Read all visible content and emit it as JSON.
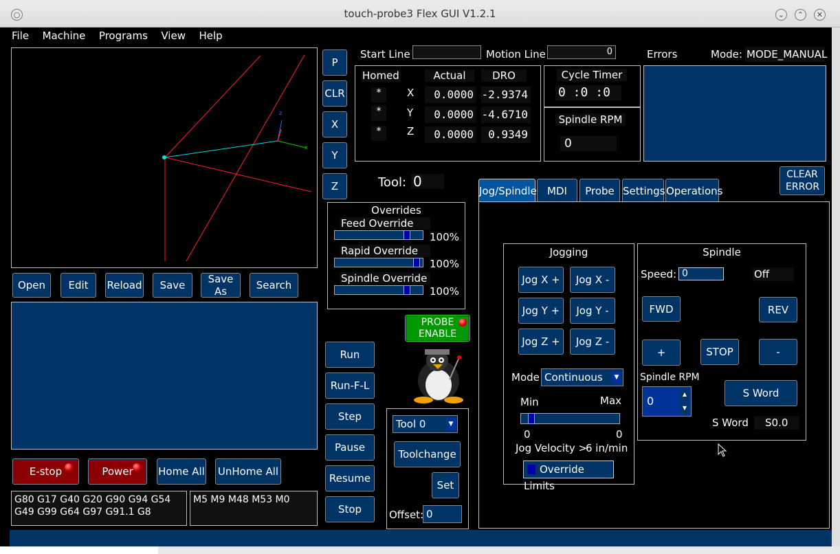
{
  "window": {
    "title": "touch-probe3 Flex GUI V1.2.1"
  },
  "menu": [
    "File",
    "Machine",
    "Programs",
    "View",
    "Help"
  ],
  "left_buttons": [
    "P",
    "CLR",
    "X",
    "Y",
    "Z"
  ],
  "file_buttons": [
    "Open",
    "Edit",
    "Reload",
    "Save",
    "Save As",
    "Search"
  ],
  "machine_buttons": {
    "estop": "E-stop",
    "power": "Power",
    "home_all": "Home All",
    "unhome_all": "UnHome All"
  },
  "gcodes": "G80 G17 G40 G20 G90 G94 G54 G49 G99 G64 G97 G91.1 G8",
  "mcodes": "M5 M9 M48 M53 M0",
  "start_line": {
    "label": "Start Line",
    "value": ""
  },
  "motion_line": {
    "label": "Motion Line",
    "value": "0"
  },
  "dro": {
    "homed_label": "Homed",
    "actual_label": "Actual",
    "dro_label": "DRO",
    "axes": [
      {
        "homed": "*",
        "axis": "X",
        "actual": "0.0000",
        "dro": "-2.9374"
      },
      {
        "homed": "*",
        "axis": "Y",
        "actual": "0.0000",
        "dro": "-4.6710"
      },
      {
        "homed": "*",
        "axis": "Z",
        "actual": "0.0000",
        "dro": "0.9349"
      }
    ]
  },
  "cycle_timer": {
    "label": "Cycle Timer",
    "h": "0",
    "m": "0",
    "s": "0"
  },
  "spindle_rpm_display": {
    "label": "Spindle RPM",
    "value": "0"
  },
  "errors": {
    "label": "Errors",
    "clear": "CLEAR ERROR"
  },
  "mode": {
    "label": "Mode:",
    "value": "MODE_MANUAL"
  },
  "tool": {
    "label": "Tool:",
    "value": "0"
  },
  "overrides": {
    "title": "Overrides",
    "feed": {
      "label": "Feed Override",
      "value": "100%",
      "level": 0.85
    },
    "rapid": {
      "label": "Rapid Override",
      "value": "100%",
      "level": 0.97
    },
    "spindle": {
      "label": "Spindle Override",
      "value": "100%",
      "level": 0.85
    }
  },
  "probe_enable": "PROBE ENABLE",
  "run_buttons": [
    "Run",
    "Run-F-L",
    "Step",
    "Pause",
    "Resume",
    "Stop"
  ],
  "toolchange": {
    "combo": "Tool 0",
    "toolchange": "Toolchange",
    "set": "Set",
    "offset_label": "Offset:",
    "offset_value": "0"
  },
  "tabs": [
    "Jog/Spindle",
    "MDI",
    "Probe",
    "Settings",
    "Operations"
  ],
  "jogging": {
    "title": "Jogging",
    "buttons": [
      "Jog X +",
      "Jog X -",
      "Jog Y +",
      "Jog Y -",
      "Jog Z +",
      "Jog Z -"
    ],
    "mode_label": "Mode",
    "mode_value": "Continuous",
    "min_label": "Min",
    "max_label": "Max",
    "min_value": "0",
    "max_value": "0",
    "velocity_label": "Jog Velocity >",
    "velocity_value": "6 in/min",
    "override_limits": "Override Limits"
  },
  "spindle": {
    "title": "Spindle",
    "speed_label": "Speed:",
    "speed_value": "0",
    "state": "Off",
    "fwd": "FWD",
    "rev": "REV",
    "plus": "+",
    "stop": "STOP",
    "minus": "-",
    "rpm_label": "Spindle RPM",
    "rpm_value": "0",
    "sword_button": "S Word",
    "sword_label": "S Word",
    "sword_value": "S0.0"
  },
  "colors": {
    "panel": "#003366",
    "estop": "#8b0000",
    "probe": "#009900"
  }
}
